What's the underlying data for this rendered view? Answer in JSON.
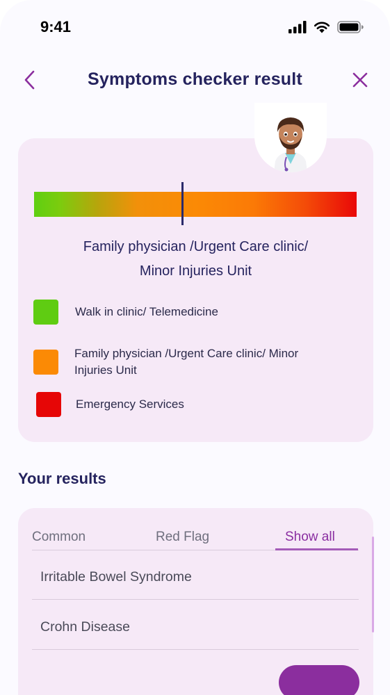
{
  "status_bar": {
    "time": "9:41",
    "icons": [
      "cellular-signal-icon",
      "wifi-icon",
      "battery-icon"
    ]
  },
  "header": {
    "title": "Symptoms checker result",
    "back_icon": "chevron-left-icon",
    "close_icon": "close-icon"
  },
  "triage": {
    "avatar": "doctor-avatar",
    "gauge_level": 0.46,
    "result_line1": "Family physician /Urgent Care clinic/",
    "result_line2": "Minor Injuries Unit",
    "legend": [
      {
        "label": "Walk in clinic/ Telemedicine",
        "color": "#5fcc12"
      },
      {
        "label_line1": "Family physician /Urgent Care clinic/ Minor",
        "label_line2": "Injuries Unit",
        "color": "#fb8a05"
      },
      {
        "label": "Emergency Services",
        "color": "#e60606"
      }
    ]
  },
  "results": {
    "title": "Your results",
    "tabs": [
      {
        "label": "Common",
        "active": false
      },
      {
        "label": "Red Flag",
        "active": false
      },
      {
        "label": "Show all",
        "active": true
      }
    ],
    "items": [
      {
        "label": "Irritable Bowel Syndrome"
      },
      {
        "label": "Crohn Disease"
      }
    ]
  },
  "colors": {
    "accent": "#8b2e9e",
    "card_bg": "#f6e9f7",
    "title_text": "#25235e"
  }
}
